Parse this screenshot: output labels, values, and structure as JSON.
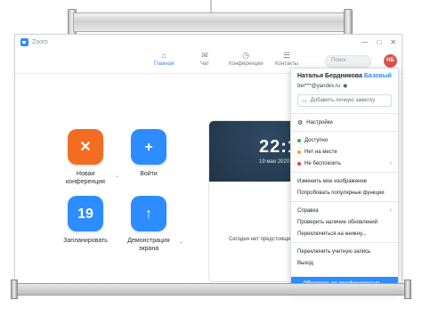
{
  "window": {
    "title": "Zoom",
    "controls": [
      "—",
      "□",
      "✕"
    ]
  },
  "nav": {
    "tabs": [
      {
        "label": "Главная",
        "icon": "home-icon",
        "glyph": "⌂",
        "active": true
      },
      {
        "label": "Чат",
        "icon": "chat-icon",
        "glyph": "✉",
        "active": false
      },
      {
        "label": "Конференции",
        "icon": "clock-icon",
        "glyph": "◷",
        "active": false
      },
      {
        "label": "Контакты",
        "icon": "contacts-icon",
        "glyph": "☰",
        "active": false
      }
    ],
    "search_placeholder": "Поиск",
    "avatar_initials": "НБ"
  },
  "actions": [
    {
      "label": "Новая конференция",
      "glyph": "✕",
      "color": "orange",
      "icon": "video-off-icon"
    },
    {
      "label": "Войти",
      "glyph": "+",
      "color": "blue",
      "icon": "plus-icon"
    },
    {
      "label": "Запланировать",
      "glyph": "19",
      "color": "blue",
      "icon": "calendar-icon"
    },
    {
      "label": "Демонстрация экрана",
      "glyph": "↑",
      "color": "blue",
      "icon": "share-screen-icon"
    }
  ],
  "calendar": {
    "time": "22:14",
    "date": "19 мая 2020 г.",
    "empty_text": "Сегодня нет предстоящих"
  },
  "profile_menu": {
    "name": "Наталья Бердникова",
    "plan": "Базовый",
    "email": "ber***@yandex.ru",
    "note_placeholder": "Добавить личную заметку",
    "items": [
      {
        "label": "Настройки",
        "icon": "gear-icon",
        "dot": "",
        "chevron": false,
        "sep_before": true
      },
      {
        "label": "Доступно",
        "icon": "status-dot",
        "dot": "#2fb24c",
        "chevron": false,
        "sep_before": true
      },
      {
        "label": "Нет на месте",
        "icon": "status-dot",
        "dot": "#f5a623",
        "chevron": false,
        "sep_before": false
      },
      {
        "label": "Не беспокоить",
        "icon": "status-dot",
        "dot": "#e0443e",
        "chevron": true,
        "sep_before": false
      },
      {
        "label": "Изменить мое изображение",
        "icon": "",
        "dot": "",
        "chevron": false,
        "sep_before": true
      },
      {
        "label": "Попробовать популярные функции",
        "icon": "",
        "dot": "",
        "chevron": false,
        "sep_before": false
      },
      {
        "label": "Справка",
        "icon": "",
        "dot": "",
        "chevron": true,
        "sep_before": true
      },
      {
        "label": "Проверить наличие обновлений",
        "icon": "",
        "dot": "",
        "chevron": false,
        "sep_before": false
      },
      {
        "label": "Переключиться на книжну...",
        "icon": "",
        "dot": "",
        "chevron": false,
        "sep_before": false
      },
      {
        "label": "Переключить учетную запись",
        "icon": "",
        "dot": "",
        "chevron": false,
        "sep_before": true
      },
      {
        "label": "Выход",
        "icon": "",
        "dot": "",
        "chevron": false,
        "sep_before": false
      }
    ],
    "upgrade_label": "Обновите до профессиональ..."
  }
}
